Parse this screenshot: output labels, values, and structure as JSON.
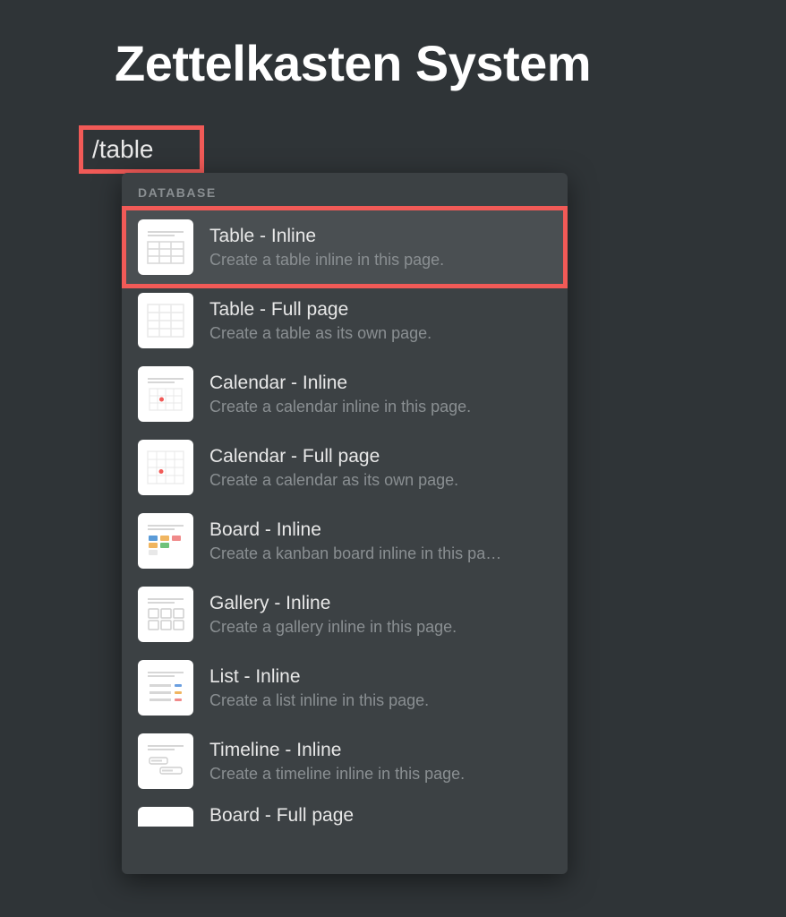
{
  "page": {
    "title": "Zettelkasten System",
    "slash_command": "/table"
  },
  "menu": {
    "section_label": "DATABASE",
    "items": [
      {
        "title": "Table - Inline",
        "desc": "Create a table inline in this page.",
        "icon": "table"
      },
      {
        "title": "Table - Full page",
        "desc": "Create a table as its own page.",
        "icon": "table"
      },
      {
        "title": "Calendar - Inline",
        "desc": "Create a calendar inline in this page.",
        "icon": "calendar"
      },
      {
        "title": "Calendar - Full page",
        "desc": "Create a calendar as its own page.",
        "icon": "calendar"
      },
      {
        "title": "Board - Inline",
        "desc": "Create a kanban board inline in this pa…",
        "icon": "board"
      },
      {
        "title": "Gallery - Inline",
        "desc": "Create a gallery inline in this page.",
        "icon": "gallery"
      },
      {
        "title": "List - Inline",
        "desc": "Create a list inline in this page.",
        "icon": "list"
      },
      {
        "title": "Timeline - Inline",
        "desc": "Create a timeline inline in this page.",
        "icon": "timeline"
      },
      {
        "title": "Board - Full page",
        "desc": "",
        "icon": "board"
      }
    ]
  },
  "annotations": {
    "highlight_color": "#f15a57"
  }
}
